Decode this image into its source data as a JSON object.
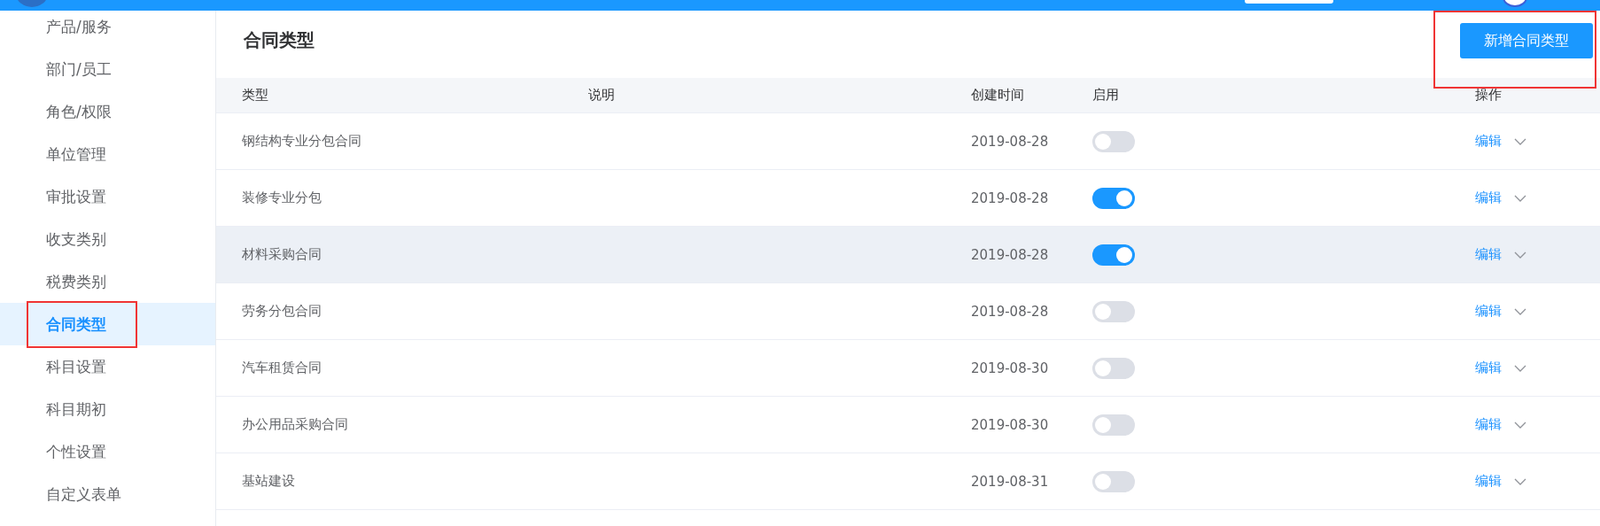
{
  "sidebar": {
    "items": [
      {
        "label": "产品/服务",
        "selected": false
      },
      {
        "label": "部门/员工",
        "selected": false
      },
      {
        "label": "角色/权限",
        "selected": false
      },
      {
        "label": "单位管理",
        "selected": false
      },
      {
        "label": "审批设置",
        "selected": false
      },
      {
        "label": "收支类别",
        "selected": false
      },
      {
        "label": "税费类别",
        "selected": false
      },
      {
        "label": "合同类型",
        "selected": true
      },
      {
        "label": "科目设置",
        "selected": false
      },
      {
        "label": "科目期初",
        "selected": false
      },
      {
        "label": "个性设置",
        "selected": false
      },
      {
        "label": "自定义表单",
        "selected": false
      }
    ]
  },
  "page_title": "合同类型",
  "add_button": "新增合同类型",
  "table": {
    "columns": [
      "类型",
      "说明",
      "创建时间",
      "启用",
      "操作"
    ],
    "rows": [
      {
        "type": "钢结构专业分包合同",
        "created": "2019-08-28",
        "enabled": false,
        "action": "编辑",
        "highlighted": false
      },
      {
        "type": "装修专业分包",
        "created": "2019-08-28",
        "enabled": true,
        "action": "编辑",
        "highlighted": false
      },
      {
        "type": "材料采购合同",
        "created": "2019-08-28",
        "enabled": true,
        "action": "编辑",
        "highlighted": true
      },
      {
        "type": "劳务分包合同",
        "created": "2019-08-28",
        "enabled": false,
        "action": "编辑",
        "highlighted": false
      },
      {
        "type": "汽车租赁合同",
        "created": "2019-08-30",
        "enabled": false,
        "action": "编辑",
        "highlighted": false
      },
      {
        "type": "办公用品采购合同",
        "created": "2019-08-30",
        "enabled": false,
        "action": "编辑",
        "highlighted": false
      },
      {
        "type": "基站建设",
        "created": "2019-08-31",
        "enabled": false,
        "action": "编辑",
        "highlighted": false
      }
    ]
  }
}
